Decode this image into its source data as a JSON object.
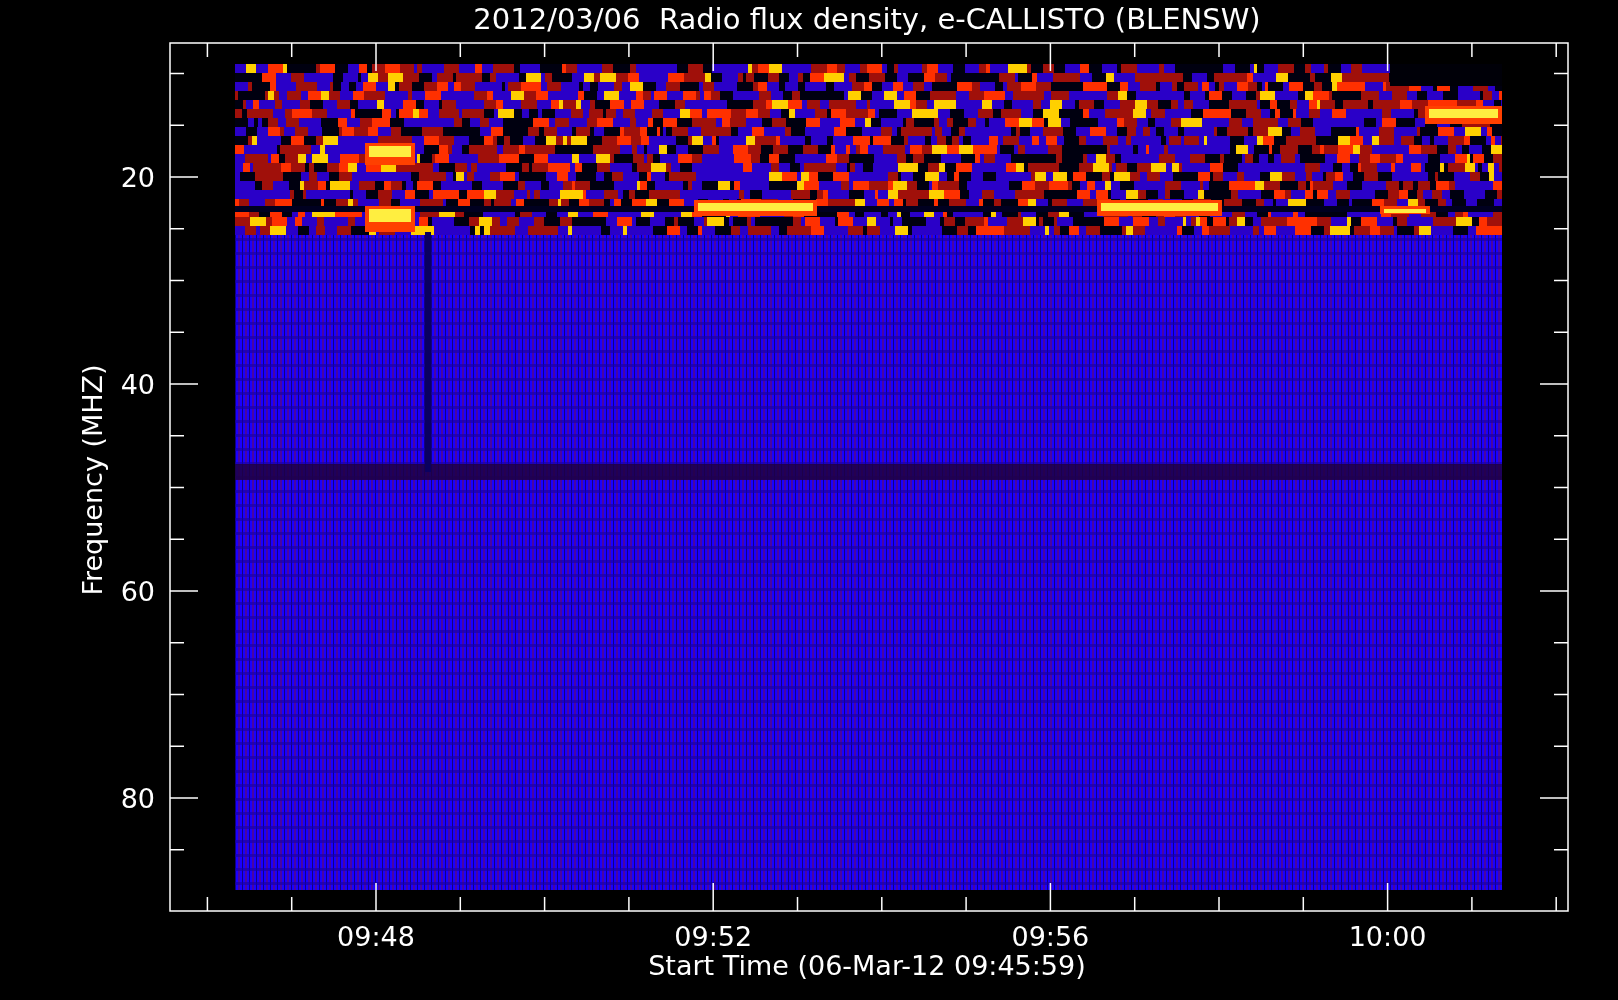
{
  "title": "2012/03/06  Radio flux density, e-CALLISTO (BLENSW)",
  "chart": {
    "ylabel": "Frequency (MHZ)",
    "xlabel": "Start Time (06-Mar-12 09:45:59)",
    "yticks": [
      "20",
      "40",
      "60",
      "80"
    ],
    "xticks": [
      "09:48",
      "09:52",
      "09:56",
      "10:00"
    ]
  }
}
